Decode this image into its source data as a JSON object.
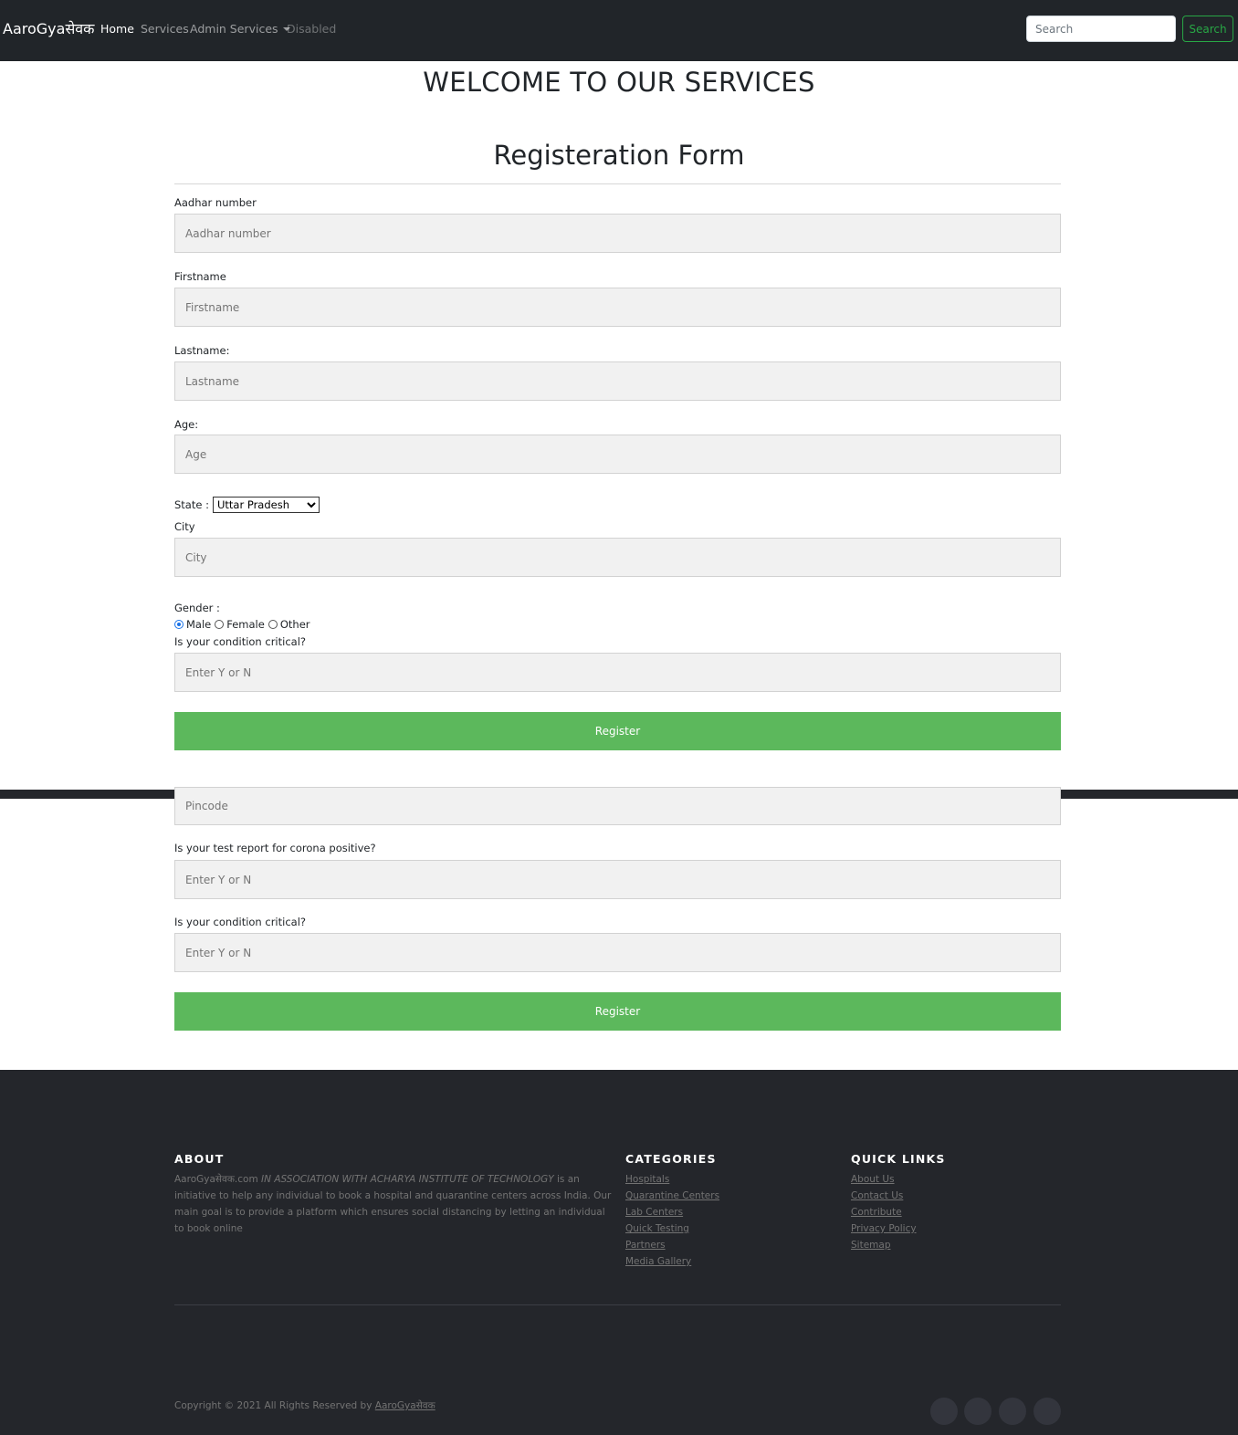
{
  "navbar": {
    "brand": "AaroGyaसेवक",
    "items": [
      {
        "label": "Home"
      },
      {
        "label": "Services"
      },
      {
        "label": "Admin Services"
      },
      {
        "label": "Disabled"
      }
    ],
    "search_placeholder": "Search",
    "search_button": "Search"
  },
  "page": {
    "welcome": "WELCOME TO OUR SERVICES",
    "form_title": "Registeration Form"
  },
  "form": {
    "aadhar": {
      "label": "Aadhar number",
      "placeholder": "Aadhar number"
    },
    "firstname": {
      "label": "Firstname",
      "placeholder": "Firstname"
    },
    "lastname": {
      "label": "Lastname:",
      "placeholder": "Lastname"
    },
    "age": {
      "label": "Age:",
      "placeholder": "Age"
    },
    "state": {
      "label": "State :",
      "selected": "Uttar Pradesh"
    },
    "city": {
      "label": "City",
      "placeholder": "City"
    },
    "gender": {
      "label": "Gender :",
      "options": [
        "Male",
        "Female",
        "Other"
      ],
      "selected": "Male"
    },
    "critical": {
      "label": "Is your condition critical?",
      "placeholder": "Enter Y or N"
    },
    "register": "Register"
  },
  "form_repeat": {
    "pincode": {
      "placeholder": "Pincode"
    },
    "corona": {
      "label": "Is your test report for corona positive?",
      "placeholder": "Enter Y or N"
    },
    "critical": {
      "label": "Is your condition critical?",
      "placeholder": "Enter Y or N"
    },
    "register": "Register"
  },
  "footer": {
    "about": {
      "heading": "ABOUT",
      "brand": "AaroGyaसेवक.com",
      "assoc": "IN ASSOCIATION WITH ACHARYA INSTITUTE OF TECHNOLOGY",
      "text": "is an initiative to help any individual to book a hospital and quarantine centers across India. Our main goal is to provide a platform which ensures social distancing by letting an individual to book online"
    },
    "categories": {
      "heading": "CATEGORIES",
      "links": [
        "Hospitals",
        "Quarantine Centers",
        "Lab Centers",
        "Quick Testing",
        "Partners",
        "Media Gallery"
      ]
    },
    "quick_links": {
      "heading": "QUICK LINKS",
      "links": [
        "About Us",
        "Contact Us",
        "Contribute",
        "Privacy Policy",
        "Sitemap"
      ]
    },
    "copyright": "Copyright © 2021 All Rights Reserved by",
    "copyright_link": "AaroGyaसेवक"
  },
  "colors": {
    "navbar_bg": "#212529",
    "register_bg": "#5cb85c",
    "footer_bg": "#24262b",
    "search_outline": "#28a745"
  }
}
